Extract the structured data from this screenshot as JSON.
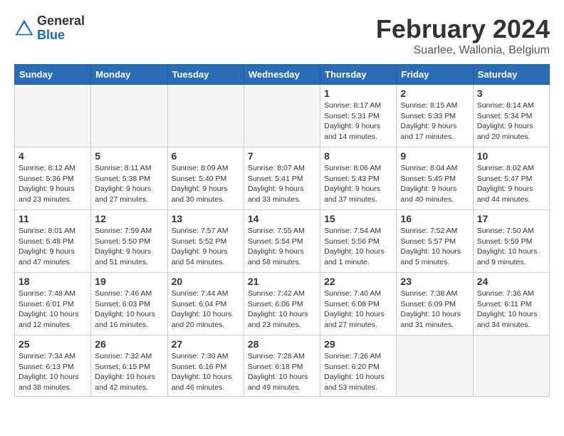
{
  "header": {
    "logo_general": "General",
    "logo_blue": "Blue",
    "month_title": "February 2024",
    "subtitle": "Suarlee, Wallonia, Belgium"
  },
  "days_of_week": [
    "Sunday",
    "Monday",
    "Tuesday",
    "Wednesday",
    "Thursday",
    "Friday",
    "Saturday"
  ],
  "weeks": [
    [
      {
        "day": "",
        "info": ""
      },
      {
        "day": "",
        "info": ""
      },
      {
        "day": "",
        "info": ""
      },
      {
        "day": "",
        "info": ""
      },
      {
        "day": "1",
        "info": "Sunrise: 8:17 AM\nSunset: 5:31 PM\nDaylight: 9 hours\nand 14 minutes."
      },
      {
        "day": "2",
        "info": "Sunrise: 8:15 AM\nSunset: 5:33 PM\nDaylight: 9 hours\nand 17 minutes."
      },
      {
        "day": "3",
        "info": "Sunrise: 8:14 AM\nSunset: 5:34 PM\nDaylight: 9 hours\nand 20 minutes."
      }
    ],
    [
      {
        "day": "4",
        "info": "Sunrise: 8:12 AM\nSunset: 5:36 PM\nDaylight: 9 hours\nand 23 minutes."
      },
      {
        "day": "5",
        "info": "Sunrise: 8:11 AM\nSunset: 5:38 PM\nDaylight: 9 hours\nand 27 minutes."
      },
      {
        "day": "6",
        "info": "Sunrise: 8:09 AM\nSunset: 5:40 PM\nDaylight: 9 hours\nand 30 minutes."
      },
      {
        "day": "7",
        "info": "Sunrise: 8:07 AM\nSunset: 5:41 PM\nDaylight: 9 hours\nand 33 minutes."
      },
      {
        "day": "8",
        "info": "Sunrise: 8:06 AM\nSunset: 5:43 PM\nDaylight: 9 hours\nand 37 minutes."
      },
      {
        "day": "9",
        "info": "Sunrise: 8:04 AM\nSunset: 5:45 PM\nDaylight: 9 hours\nand 40 minutes."
      },
      {
        "day": "10",
        "info": "Sunrise: 8:02 AM\nSunset: 5:47 PM\nDaylight: 9 hours\nand 44 minutes."
      }
    ],
    [
      {
        "day": "11",
        "info": "Sunrise: 8:01 AM\nSunset: 5:48 PM\nDaylight: 9 hours\nand 47 minutes."
      },
      {
        "day": "12",
        "info": "Sunrise: 7:59 AM\nSunset: 5:50 PM\nDaylight: 9 hours\nand 51 minutes."
      },
      {
        "day": "13",
        "info": "Sunrise: 7:57 AM\nSunset: 5:52 PM\nDaylight: 9 hours\nand 54 minutes."
      },
      {
        "day": "14",
        "info": "Sunrise: 7:55 AM\nSunset: 5:54 PM\nDaylight: 9 hours\nand 58 minutes."
      },
      {
        "day": "15",
        "info": "Sunrise: 7:54 AM\nSunset: 5:56 PM\nDaylight: 10 hours\nand 1 minute."
      },
      {
        "day": "16",
        "info": "Sunrise: 7:52 AM\nSunset: 5:57 PM\nDaylight: 10 hours\nand 5 minutes."
      },
      {
        "day": "17",
        "info": "Sunrise: 7:50 AM\nSunset: 5:59 PM\nDaylight: 10 hours\nand 9 minutes."
      }
    ],
    [
      {
        "day": "18",
        "info": "Sunrise: 7:48 AM\nSunset: 6:01 PM\nDaylight: 10 hours\nand 12 minutes."
      },
      {
        "day": "19",
        "info": "Sunrise: 7:46 AM\nSunset: 6:03 PM\nDaylight: 10 hours\nand 16 minutes."
      },
      {
        "day": "20",
        "info": "Sunrise: 7:44 AM\nSunset: 6:04 PM\nDaylight: 10 hours\nand 20 minutes."
      },
      {
        "day": "21",
        "info": "Sunrise: 7:42 AM\nSunset: 6:06 PM\nDaylight: 10 hours\nand 23 minutes."
      },
      {
        "day": "22",
        "info": "Sunrise: 7:40 AM\nSunset: 6:08 PM\nDaylight: 10 hours\nand 27 minutes."
      },
      {
        "day": "23",
        "info": "Sunrise: 7:38 AM\nSunset: 6:09 PM\nDaylight: 10 hours\nand 31 minutes."
      },
      {
        "day": "24",
        "info": "Sunrise: 7:36 AM\nSunset: 6:11 PM\nDaylight: 10 hours\nand 34 minutes."
      }
    ],
    [
      {
        "day": "25",
        "info": "Sunrise: 7:34 AM\nSunset: 6:13 PM\nDaylight: 10 hours\nand 38 minutes."
      },
      {
        "day": "26",
        "info": "Sunrise: 7:32 AM\nSunset: 6:15 PM\nDaylight: 10 hours\nand 42 minutes."
      },
      {
        "day": "27",
        "info": "Sunrise: 7:30 AM\nSunset: 6:16 PM\nDaylight: 10 hours\nand 46 minutes."
      },
      {
        "day": "28",
        "info": "Sunrise: 7:28 AM\nSunset: 6:18 PM\nDaylight: 10 hours\nand 49 minutes."
      },
      {
        "day": "29",
        "info": "Sunrise: 7:26 AM\nSunset: 6:20 PM\nDaylight: 10 hours\nand 53 minutes."
      },
      {
        "day": "",
        "info": ""
      },
      {
        "day": "",
        "info": ""
      }
    ]
  ]
}
